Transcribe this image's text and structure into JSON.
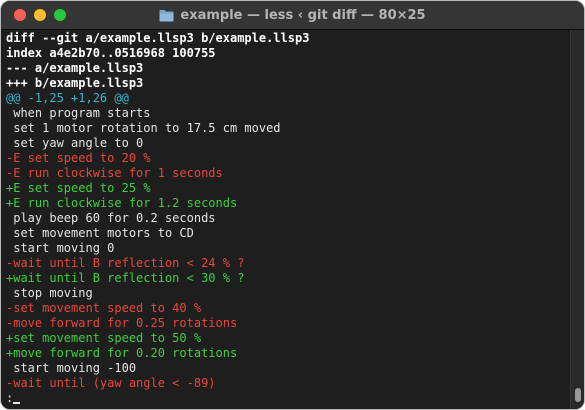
{
  "window": {
    "title": "example — less ‹ git diff — 80×25"
  },
  "lines": [
    {
      "type": "hdr",
      "text": "diff --git a/example.llsp3 b/example.llsp3"
    },
    {
      "type": "hdr",
      "text": "index a4e2b70..0516968 100755"
    },
    {
      "type": "hdr",
      "text": "--- a/example.llsp3"
    },
    {
      "type": "hdr",
      "text": "+++ b/example.llsp3"
    },
    {
      "type": "hunk",
      "text": "@@ -1,25 +1,26 @@"
    },
    {
      "type": "ctx",
      "text": " when program starts"
    },
    {
      "type": "ctx",
      "text": " set 1 motor rotation to 17.5 cm moved"
    },
    {
      "type": "ctx",
      "text": " set yaw angle to 0"
    },
    {
      "type": "del",
      "text": "-E set speed to 20 %"
    },
    {
      "type": "del",
      "text": "-E run clockwise for 1 seconds"
    },
    {
      "type": "add",
      "text": "+E set speed to 25 %"
    },
    {
      "type": "add",
      "text": "+E run clockwise for 1.2 seconds"
    },
    {
      "type": "ctx",
      "text": " play beep 60 for 0.2 seconds"
    },
    {
      "type": "ctx",
      "text": " set movement motors to CD"
    },
    {
      "type": "ctx",
      "text": " start moving 0"
    },
    {
      "type": "del",
      "text": "-wait until B reflection < 24 % ?"
    },
    {
      "type": "add",
      "text": "+wait until B reflection < 30 % ?"
    },
    {
      "type": "ctx",
      "text": " stop moving"
    },
    {
      "type": "del",
      "text": "-set movement speed to 40 %"
    },
    {
      "type": "del",
      "text": "-move forward for 0.25 rotations"
    },
    {
      "type": "add",
      "text": "+set movement speed to 50 %"
    },
    {
      "type": "add",
      "text": "+move forward for 0.20 rotations"
    },
    {
      "type": "ctx",
      "text": " start moving -100"
    },
    {
      "type": "del",
      "text": "-wait until (yaw angle < -89)"
    }
  ],
  "prompt": {
    "text": ":"
  },
  "colors": {
    "header": "#ffffff",
    "hunk": "#3bb5c8",
    "context": "#e4e4e4",
    "deleted": "#e8473a",
    "added": "#3fcf3f",
    "background": "#1e1e1e"
  },
  "icons": {
    "title": "folder-icon"
  }
}
